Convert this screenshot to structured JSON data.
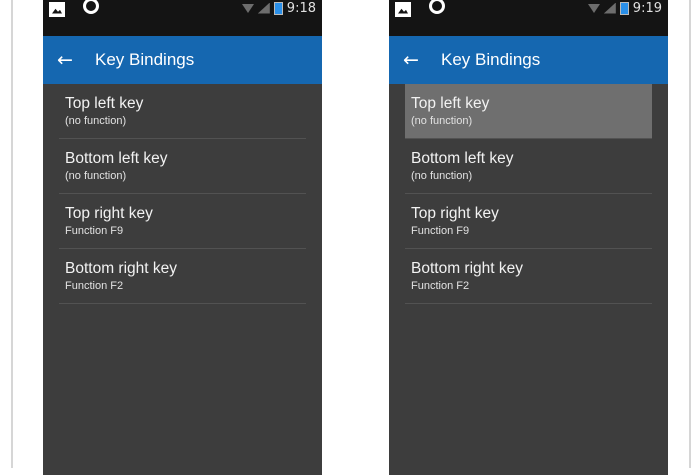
{
  "screens": [
    {
      "status": {
        "time": "9:18"
      },
      "appbar": {
        "back": "←",
        "title": "Key Bindings"
      },
      "items": [
        {
          "title": "Top left key",
          "subtitle": "(no function)"
        },
        {
          "title": "Bottom left key",
          "subtitle": "(no function)"
        },
        {
          "title": "Top right key",
          "subtitle": "Function F9"
        },
        {
          "title": "Bottom right key",
          "subtitle": "Function F2"
        }
      ],
      "highlighted_index": null
    },
    {
      "status": {
        "time": "9:19"
      },
      "appbar": {
        "back": "←",
        "title": "Key Bindings"
      },
      "items": [
        {
          "title": "Top left key",
          "subtitle": "(no function)"
        },
        {
          "title": "Bottom left key",
          "subtitle": "(no function)"
        },
        {
          "title": "Top right key",
          "subtitle": "Function F9"
        },
        {
          "title": "Bottom right key",
          "subtitle": "Function F2"
        }
      ],
      "highlighted_index": 0
    }
  ],
  "colors": {
    "appbar": "#1567b0",
    "background": "#3d3d3d",
    "statusbar": "#141414",
    "highlight": "#6f6f6f",
    "battery": "#2a8fe8"
  },
  "icons": [
    "image-icon",
    "ring-icon",
    "wifi-icon",
    "signal-icon",
    "battery-icon",
    "back-arrow-icon"
  ]
}
